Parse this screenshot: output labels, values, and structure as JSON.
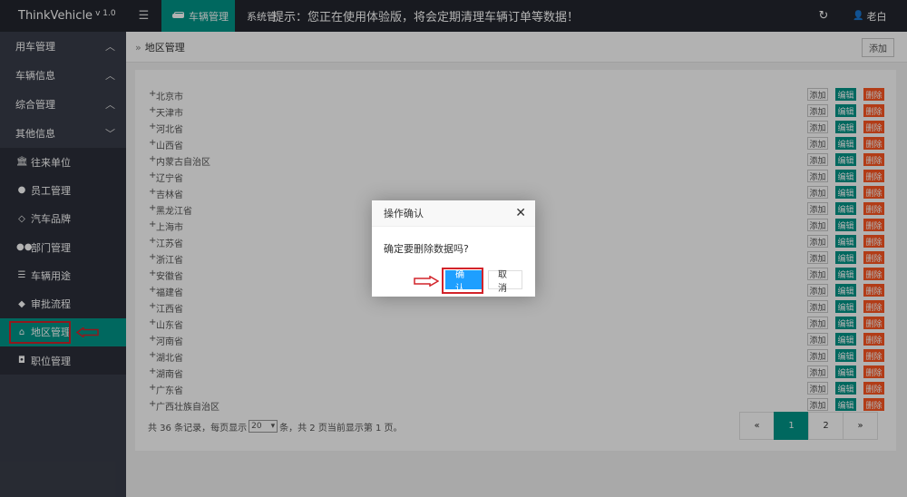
{
  "topbar": {
    "brand": "ThinkVehicle",
    "version": "v 1.0",
    "menu_toggle_icon": "menu-icon",
    "active_nav": "车辆管理",
    "system_nav": "系统管",
    "notice": "提示：您正在使用体验版，将会定期清理车辆订单等数据！",
    "user_name": "老白"
  },
  "sidebar": {
    "groups": [
      {
        "label": "用车管理"
      },
      {
        "label": "车辆信息"
      },
      {
        "label": "综合管理"
      },
      {
        "label": "其他信息"
      }
    ],
    "items": [
      {
        "label": "往来单位",
        "icon": "bank-icon"
      },
      {
        "label": "员工管理",
        "icon": "user-icon"
      },
      {
        "label": "汽车品牌",
        "icon": "diamond-icon"
      },
      {
        "label": "部门管理",
        "icon": "users-icon"
      },
      {
        "label": "车辆用途",
        "icon": "list-icon"
      },
      {
        "label": "审批流程",
        "icon": "android-icon"
      },
      {
        "label": "地区管理",
        "icon": "home-icon"
      },
      {
        "label": "职位管理",
        "icon": "camera-icon"
      }
    ],
    "active_item": "地区管理"
  },
  "main": {
    "breadcrumb": "地区管理",
    "add_button": "添加",
    "row_buttons": {
      "add": "添加",
      "edit": "编辑",
      "delete": "删除"
    },
    "regions": [
      "北京市",
      "天津市",
      "河北省",
      "山西省",
      "内蒙古自治区",
      "辽宁省",
      "吉林省",
      "黑龙江省",
      "上海市",
      "江苏省",
      "浙江省",
      "安徽省",
      "福建省",
      "江西省",
      "山东省",
      "河南省",
      "湖北省",
      "湖南省",
      "广东省",
      "广西壮族自治区"
    ],
    "pager": {
      "info_prefix": "共 36 条记录，每页显示",
      "page_size": "20",
      "info_suffix": "条，共 2 页当前显示第 1 页。",
      "prev": "«",
      "pages": [
        "1",
        "2"
      ],
      "current": "1",
      "next": "»"
    }
  },
  "dialog": {
    "title": "操作确认",
    "message": "确定要删除数据吗?",
    "confirm": "确认",
    "cancel": "取消"
  },
  "colors": {
    "accent": "#009688",
    "danger": "#ff5722",
    "primary": "#1e9fff",
    "annotation": "#d2232a"
  }
}
